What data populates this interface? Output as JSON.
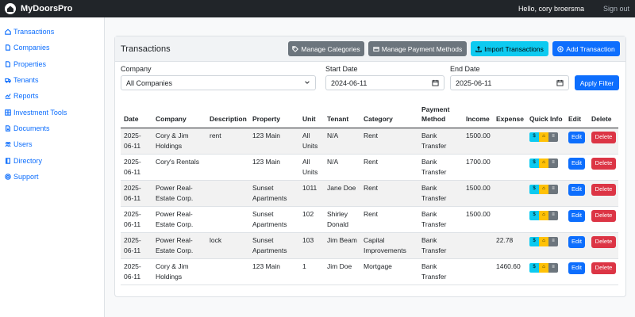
{
  "app": {
    "brand": "MyDoorsPro",
    "greeting": "Hello, cory broersma",
    "signout": "Sign out"
  },
  "sidebar": {
    "items": [
      {
        "label": "Transactions",
        "icon": "home-icon"
      },
      {
        "label": "Companies",
        "icon": "file-icon"
      },
      {
        "label": "Properties",
        "icon": "file-icon"
      },
      {
        "label": "Tenants",
        "icon": "truck-icon"
      },
      {
        "label": "Reports",
        "icon": "chart-icon"
      },
      {
        "label": "Investment Tools",
        "icon": "grid-icon"
      },
      {
        "label": "Documents",
        "icon": "document-icon"
      },
      {
        "label": "Users",
        "icon": "users-icon"
      },
      {
        "label": "Directory",
        "icon": "book-icon"
      },
      {
        "label": "Support",
        "icon": "support-icon"
      }
    ]
  },
  "header": {
    "title": "Transactions",
    "manage_categories": "Manage Categories",
    "manage_payment_methods": "Manage Payment Methods",
    "import_transactions": "Import Transactions",
    "add_transaction": "Add Transaction"
  },
  "filters": {
    "company_label": "Company",
    "company_value": "All Companies",
    "start_label": "Start Date",
    "start_value": "2024-06-11",
    "end_label": "End Date",
    "end_value": "2025-06-11",
    "apply": "Apply Filter"
  },
  "table": {
    "headers": {
      "date": "Date",
      "company": "Company",
      "description": "Description",
      "property": "Property",
      "unit": "Unit",
      "tenant": "Tenant",
      "category": "Category",
      "payment": "Payment Method",
      "income": "Income",
      "expense": "Expense",
      "quick": "Quick Info",
      "edit": "Edit",
      "delete": "Delete"
    },
    "rows": [
      {
        "date": "2025-06-11",
        "company": "Cory & Jim Holdings",
        "description": "rent",
        "property": "123 Main",
        "unit": "All Units",
        "tenant": "N/A",
        "category": "Rent",
        "payment": "Bank Transfer",
        "income": "1500.00",
        "expense": ""
      },
      {
        "date": "2025-06-11",
        "company": "Cory's Rentals",
        "description": "",
        "property": "123 Main",
        "unit": "All Units",
        "tenant": "N/A",
        "category": "Rent",
        "payment": "Bank Transfer",
        "income": "1700.00",
        "expense": ""
      },
      {
        "date": "2025-06-11",
        "company": "Power Real-Estate Corp.",
        "description": "",
        "property": "Sunset Apartments",
        "unit": "1011",
        "tenant": "Jane Doe",
        "category": "Rent",
        "payment": "Bank Transfer",
        "income": "1500.00",
        "expense": ""
      },
      {
        "date": "2025-06-11",
        "company": "Power Real-Estate Corp.",
        "description": "",
        "property": "Sunset Apartments",
        "unit": "102",
        "tenant": "Shirley Donald",
        "category": "Rent",
        "payment": "Bank Transfer",
        "income": "1500.00",
        "expense": ""
      },
      {
        "date": "2025-06-11",
        "company": "Power Real-Estate Corp.",
        "description": "lock",
        "property": "Sunset Apartments",
        "unit": "103",
        "tenant": "Jim Beam",
        "category": "Capital Improvements",
        "payment": "Bank Transfer",
        "income": "",
        "expense": "22.78"
      },
      {
        "date": "2025-06-11",
        "company": "Cory & Jim Holdings",
        "description": "",
        "property": "123 Main",
        "unit": "1",
        "tenant": "Jim Doe",
        "category": "Mortgage",
        "payment": "Bank Transfer",
        "income": "",
        "expense": "1460.60"
      }
    ],
    "quick_info": {
      "q1": "$",
      "q2": "⌂",
      "q3": "≡"
    },
    "edit_label": "Edit",
    "delete_label": "Delete"
  }
}
